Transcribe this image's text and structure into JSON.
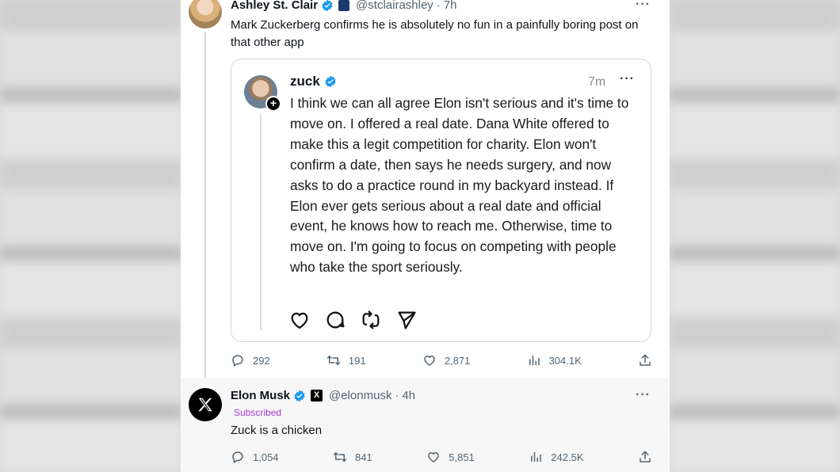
{
  "tweet": {
    "author_name": "Ashley St. Clair",
    "handle": "@stclairashley",
    "separator": "·",
    "time": "7h",
    "more": "···",
    "text": "Mark Zuckerberg confirms he is absolutely no fun in a painfully boring post on that other app",
    "stats": {
      "replies": "292",
      "reposts": "191",
      "likes": "2,871",
      "views": "304.1K"
    }
  },
  "quote": {
    "author_name": "zuck",
    "time": "7m",
    "more": "···",
    "plus": "+",
    "text": "I think we can all agree Elon isn't serious and it's time to move on. I offered a real date. Dana White offered to make this a legit competition for charity. Elon won't confirm a date, then says he needs surgery, and now asks to do a practice round in my backyard instead. If Elon ever gets serious about a real date and official event, he knows how to reach me. Otherwise, time to move on. I'm going to focus on competing with people who take the sport seriously."
  },
  "reply": {
    "author_name": "Elon Musk",
    "handle": "@elonmusk",
    "separator": "·",
    "time": "4h",
    "more": "···",
    "badge_label": "Subscribed",
    "x_logo": "X",
    "text": "Zuck is a chicken",
    "stats": {
      "replies": "1,054",
      "reposts": "841",
      "likes": "5,851",
      "views": "242.5K"
    }
  },
  "colors": {
    "verified": "#1d9bf0",
    "muted": "#536471",
    "subscribed": "#a23ad1"
  }
}
